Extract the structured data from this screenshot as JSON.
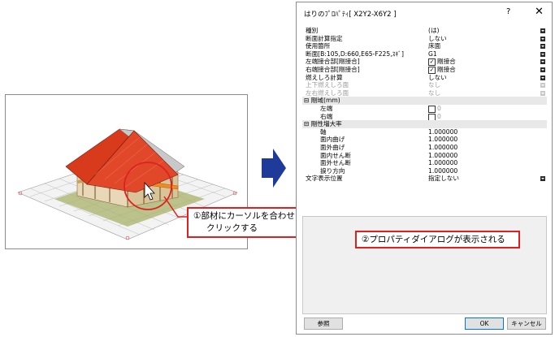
{
  "callout_left": {
    "line1": "①部材にカーソルを合わせ",
    "line2": "クリックする"
  },
  "callout_right": "②プロパティダイアログが表示される",
  "dialog": {
    "title": "はりのﾌﾟﾛﾊﾟﾃｨ[ X2Y2-X6Y2 ]",
    "help": "?",
    "close": "✕",
    "rows": [
      {
        "label": "種別",
        "value": "(は)"
      },
      {
        "label": "断面計算指定",
        "value": "しない"
      },
      {
        "label": "使用箇所",
        "value": "床面"
      },
      {
        "label": "断面[B:105,D:660,E65-F225,ｽｷﾞ]",
        "value": "G1"
      },
      {
        "label": "左端接合部[剛接合]",
        "value": "剛接合",
        "check": "☑"
      },
      {
        "label": "右端接合部[剛接合]",
        "value": "剛接合",
        "check": "☑"
      },
      {
        "label": "燃えしろ計算",
        "value": "しない"
      },
      {
        "label": "上下燃えしろ面",
        "value": "なし"
      },
      {
        "label": "左右燃えしろ面",
        "value": "なし"
      }
    ],
    "group1": {
      "toggle": "⊟",
      "label": "剛域(mm)"
    },
    "rigid_rows": [
      {
        "label": "左端",
        "value": "0"
      },
      {
        "label": "右端",
        "value": "0"
      }
    ],
    "group2": {
      "toggle": "⊟",
      "label": "剛性増大率"
    },
    "stiff_rows": [
      {
        "label": "軸",
        "value": "1.000000"
      },
      {
        "label": "面内曲げ",
        "value": "1.000000"
      },
      {
        "label": "面外曲げ",
        "value": "1.000000"
      },
      {
        "label": "面内せん断",
        "value": "1.000000"
      },
      {
        "label": "面外せん断",
        "value": "1.000000"
      },
      {
        "label": "捩り方向",
        "value": "1.000000"
      }
    ],
    "text_pos": {
      "label": "文字表示位置",
      "value": "指定しない"
    },
    "buttons": {
      "ref": "参照",
      "ok": "OK",
      "cancel": "キャンセル"
    }
  }
}
